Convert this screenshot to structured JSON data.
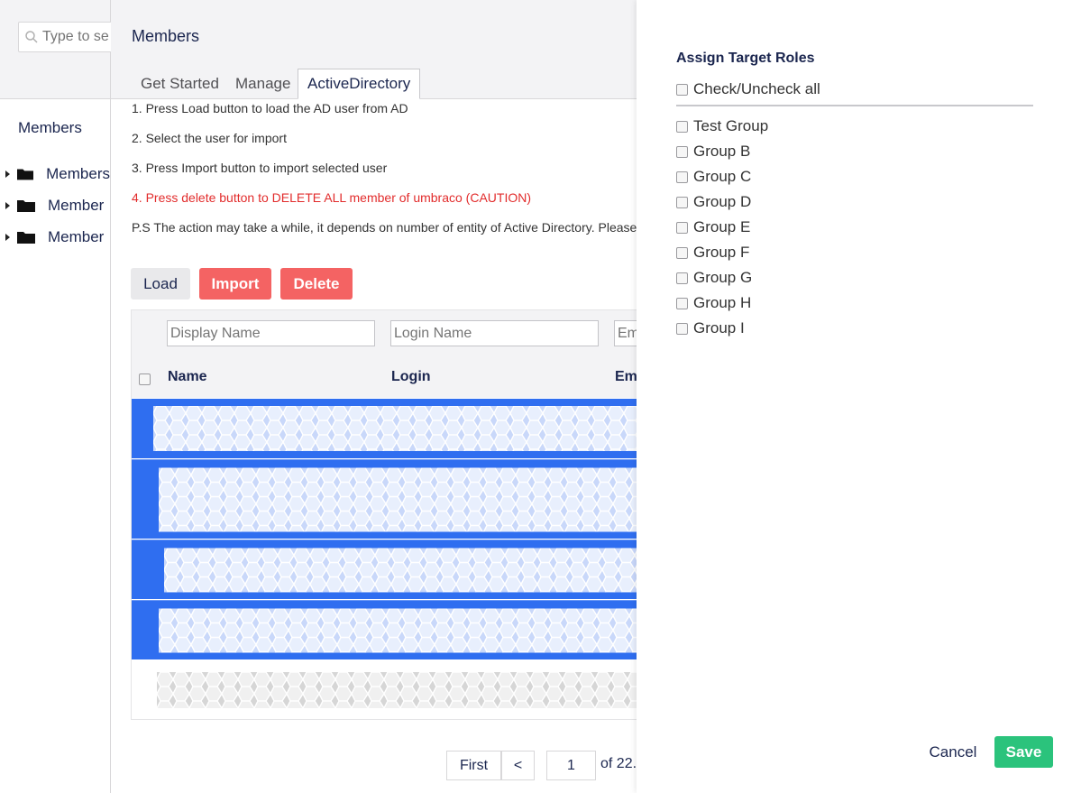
{
  "left_panel": {
    "search_placeholder": "Type to se",
    "tree_title": "Members",
    "tree_items": [
      {
        "label": "Members"
      },
      {
        "label": "Member "
      },
      {
        "label": "Member "
      }
    ]
  },
  "main": {
    "title": "Members",
    "tabs": [
      {
        "label": "Get Started"
      },
      {
        "label": "Manage"
      },
      {
        "label": "ActiveDirectory",
        "active": true
      }
    ],
    "instructions": [
      "1. Press Load button to load the AD user from AD",
      "2. Select the user for import",
      "3. Press Import button to import selected user",
      "4. Press delete button to DELETE ALL member of umbraco (CAUTION)",
      "P.S The action may take a while, it depends on number of entity of Active Directory. Please pa"
    ],
    "buttons": {
      "load": "Load",
      "import": "Import",
      "delete": "Delete"
    },
    "grid": {
      "filters": {
        "display_name": "Display Name",
        "login_name": "Login Name",
        "email": "Em"
      },
      "columns": [
        "Name",
        "Login",
        "Ema"
      ],
      "rows": [
        {
          "selected": true
        },
        {
          "selected": true
        },
        {
          "selected": true
        },
        {
          "selected": true
        },
        {
          "selected": false
        }
      ]
    },
    "pagination": {
      "first": "First",
      "prev": "<",
      "page": "1",
      "of_text": "of 22."
    }
  },
  "dialog": {
    "title": "Assign Target Roles",
    "check_all": "Check/Uncheck all",
    "roles": [
      "Test Group",
      "Group B",
      "Group C",
      "Group D",
      "Group E",
      "Group F",
      "Group G",
      "Group H",
      "Group I"
    ],
    "cancel": "Cancel",
    "save": "Save"
  },
  "colors": {
    "selected_row": "#2f6ef0",
    "danger_button": "#f46363",
    "save_button": "#2bc37c",
    "warning_text": "#e22c2c"
  }
}
